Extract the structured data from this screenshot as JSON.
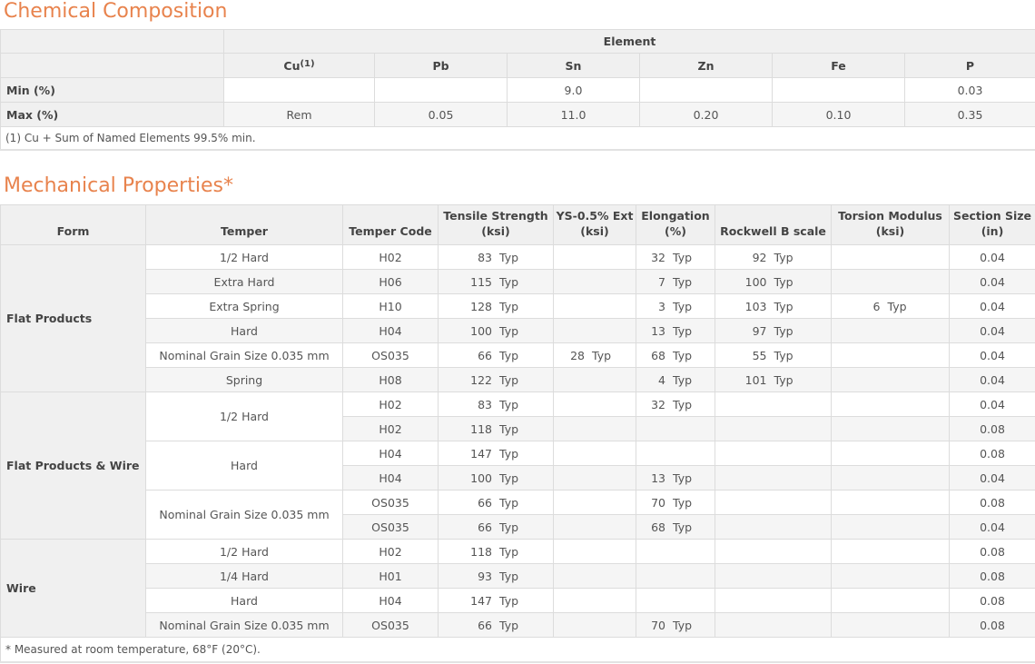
{
  "chemical": {
    "title": "Chemical Composition",
    "element_header": "Element",
    "cu_label": "Cu",
    "cu_sup": "(1)",
    "elements": [
      "Pb",
      "Sn",
      "Zn",
      "Fe",
      "P"
    ],
    "rows": [
      {
        "label": "Min (%)",
        "cu": "",
        "values": [
          "",
          "9.0",
          "",
          "",
          "0.03"
        ]
      },
      {
        "label": "Max (%)",
        "cu": "Rem",
        "values": [
          "0.05",
          "11.0",
          "0.20",
          "0.10",
          "0.35"
        ]
      }
    ],
    "note": "(1) Cu + Sum of Named Elements 99.5% min."
  },
  "mechanical": {
    "title": "Mechanical Properties*",
    "headers": {
      "form": "Form",
      "temper": "Temper",
      "temper_code": "Temper Code",
      "tensile": [
        "Tensile Strength",
        "(ksi)"
      ],
      "ys": [
        "YS-0.5% Ext",
        "(ksi)"
      ],
      "elongation": [
        "Elongation",
        "(%)"
      ],
      "rockwell": "Rockwell B scale",
      "torsion": [
        "Torsion Modulus",
        "(ksi)"
      ],
      "section": [
        "Section Size",
        "(in)"
      ]
    },
    "typ_label": "Typ",
    "groups": [
      {
        "form": "Flat Products",
        "rows": [
          {
            "temper": "1/2 Hard",
            "code": "H02",
            "ts": "83",
            "ys": "",
            "el": "32",
            "rb": "92",
            "tm": "",
            "size": "0.04"
          },
          {
            "temper": "Extra Hard",
            "code": "H06",
            "ts": "115",
            "ys": "",
            "el": "7",
            "rb": "100",
            "tm": "",
            "size": "0.04"
          },
          {
            "temper": "Extra Spring",
            "code": "H10",
            "ts": "128",
            "ys": "",
            "el": "3",
            "rb": "103",
            "tm": "6",
            "size": "0.04"
          },
          {
            "temper": "Hard",
            "code": "H04",
            "ts": "100",
            "ys": "",
            "el": "13",
            "rb": "97",
            "tm": "",
            "size": "0.04"
          },
          {
            "temper": "Nominal Grain Size 0.035 mm",
            "code": "OS035",
            "ts": "66",
            "ys": "28",
            "el": "68",
            "rb": "55",
            "tm": "",
            "size": "0.04"
          },
          {
            "temper": "Spring",
            "code": "H08",
            "ts": "122",
            "ys": "",
            "el": "4",
            "rb": "101",
            "tm": "",
            "size": "0.04"
          }
        ]
      },
      {
        "form": "Flat Products & Wire",
        "rows": [
          {
            "temper": "1/2 Hard",
            "code": "H02",
            "ts": "83",
            "ys": "",
            "el": "32",
            "rb": "",
            "tm": "",
            "size": "0.04"
          },
          {
            "temper": "1/2 Hard",
            "code": "H02",
            "ts": "118",
            "ys": "",
            "el": "",
            "rb": "",
            "tm": "",
            "size": "0.08"
          },
          {
            "temper": "Hard",
            "code": "H04",
            "ts": "147",
            "ys": "",
            "el": "",
            "rb": "",
            "tm": "",
            "size": "0.08"
          },
          {
            "temper": "Hard",
            "code": "H04",
            "ts": "100",
            "ys": "",
            "el": "13",
            "rb": "",
            "tm": "",
            "size": "0.04"
          },
          {
            "temper": "Nominal Grain Size 0.035 mm",
            "code": "OS035",
            "ts": "66",
            "ys": "",
            "el": "70",
            "rb": "",
            "tm": "",
            "size": "0.08"
          },
          {
            "temper": "Nominal Grain Size 0.035 mm",
            "code": "OS035",
            "ts": "66",
            "ys": "",
            "el": "68",
            "rb": "",
            "tm": "",
            "size": "0.04"
          }
        ]
      },
      {
        "form": "Wire",
        "rows": [
          {
            "temper": "1/2 Hard",
            "code": "H02",
            "ts": "118",
            "ys": "",
            "el": "",
            "rb": "",
            "tm": "",
            "size": "0.08"
          },
          {
            "temper": "1/4 Hard",
            "code": "H01",
            "ts": "93",
            "ys": "",
            "el": "",
            "rb": "",
            "tm": "",
            "size": "0.08"
          },
          {
            "temper": "Hard",
            "code": "H04",
            "ts": "147",
            "ys": "",
            "el": "",
            "rb": "",
            "tm": "",
            "size": "0.08"
          },
          {
            "temper": "Nominal Grain Size 0.035 mm",
            "code": "OS035",
            "ts": "66",
            "ys": "",
            "el": "70",
            "rb": "",
            "tm": "",
            "size": "0.08"
          }
        ]
      }
    ],
    "note": "* Measured at room temperature, 68°F (20°C)."
  }
}
